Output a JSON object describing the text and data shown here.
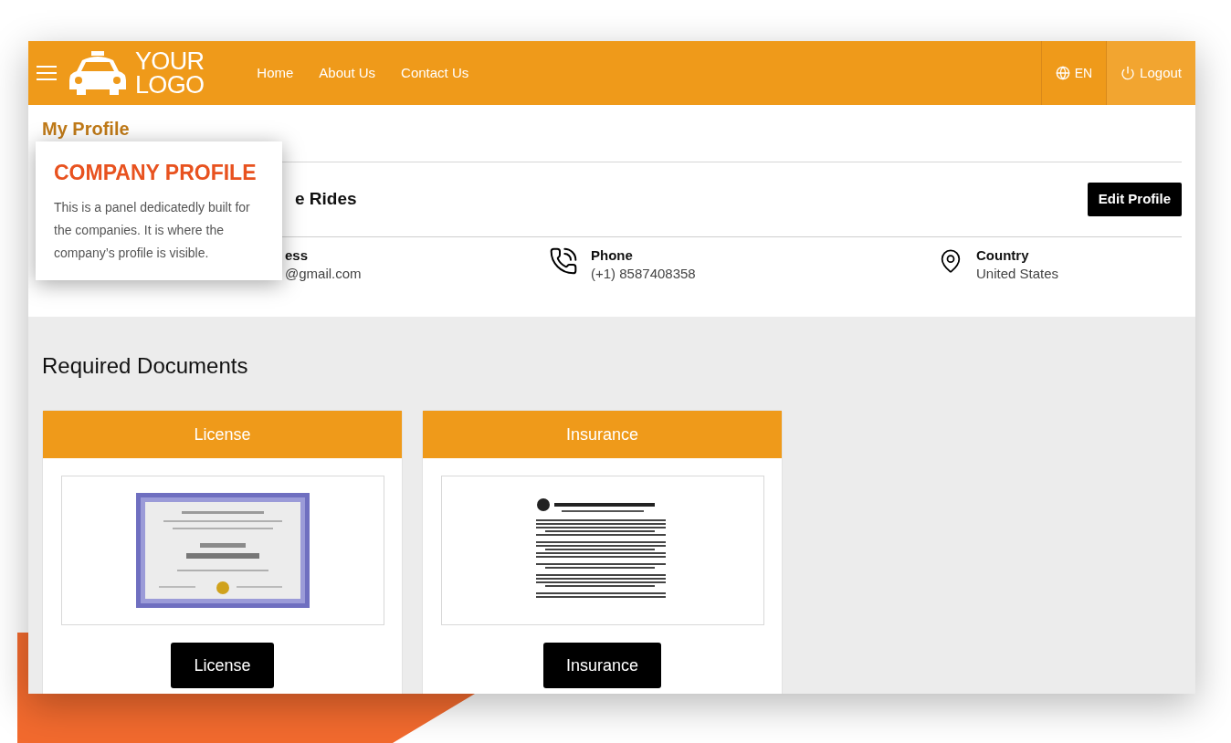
{
  "header": {
    "logo": [
      "YOUR",
      "LOGO"
    ],
    "links": [
      {
        "label": "Home"
      },
      {
        "label": "About Us"
      },
      {
        "label": "Contact Us"
      }
    ],
    "language": "EN",
    "logout": "Logout"
  },
  "profile": {
    "title": "My Profile",
    "company_name": "e Rides",
    "edit_button": "Edit Profile",
    "details": [
      {
        "kind": "email",
        "label": "ess",
        "value": "@gmail.com"
      },
      {
        "kind": "phone",
        "label": "Phone",
        "value": "(+1) 8587408358"
      },
      {
        "kind": "location",
        "label": "Country",
        "value": "United States"
      }
    ]
  },
  "callout": {
    "title": "COMPANY PROFILE",
    "text": "This is a panel dedicatedly built for the companies. It is where the company’s profile is visible."
  },
  "documents": {
    "title": "Required Documents",
    "cards": [
      {
        "kind": "certificate",
        "title": "License",
        "button": "License"
      },
      {
        "kind": "letter",
        "title": "Insurance",
        "button": "Insurance"
      }
    ]
  }
}
